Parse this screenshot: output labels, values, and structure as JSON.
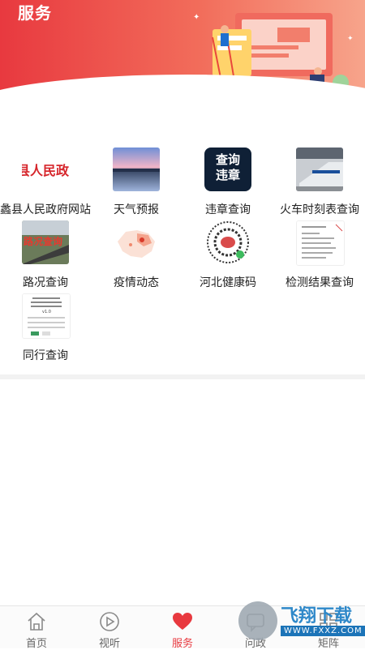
{
  "header": {
    "title": "服务"
  },
  "services": [
    {
      "label": "蠡县人民政府网站",
      "icon": "gov-website-thumb",
      "thumb_text": "县人民政"
    },
    {
      "label": "天气预报",
      "icon": "weather-photo-thumb"
    },
    {
      "label": "违章查询",
      "icon": "violation-query-thumb",
      "thumb_text_1": "查询",
      "thumb_text_2": "违章"
    },
    {
      "label": "火车时刻表查询",
      "icon": "train-photo-thumb"
    },
    {
      "label": "路况查询",
      "icon": "road-photo-thumb",
      "thumb_text": "路况查询"
    },
    {
      "label": "疫情动态",
      "icon": "epidemic-map-thumb"
    },
    {
      "label": "河北健康码",
      "icon": "health-qr-thumb"
    },
    {
      "label": "检测结果查询",
      "icon": "test-result-doc-thumb"
    },
    {
      "label": "同行查询",
      "icon": "companion-query-thumb",
      "thumb_text": "v1.0"
    }
  ],
  "tabbar": {
    "items": [
      {
        "label": "首页",
        "icon": "home-icon"
      },
      {
        "label": "视听",
        "icon": "play-icon"
      },
      {
        "label": "服务",
        "icon": "heart-icon",
        "active": true
      },
      {
        "label": "问政",
        "icon": "question-icon"
      },
      {
        "label": "矩阵",
        "icon": "matrix-icon"
      }
    ]
  },
  "watermark": {
    "text": "飞翔下载",
    "url": "WWW.FXXZ.COM"
  },
  "colors": {
    "accent": "#e8393f",
    "header_end": "#f7a48b"
  }
}
